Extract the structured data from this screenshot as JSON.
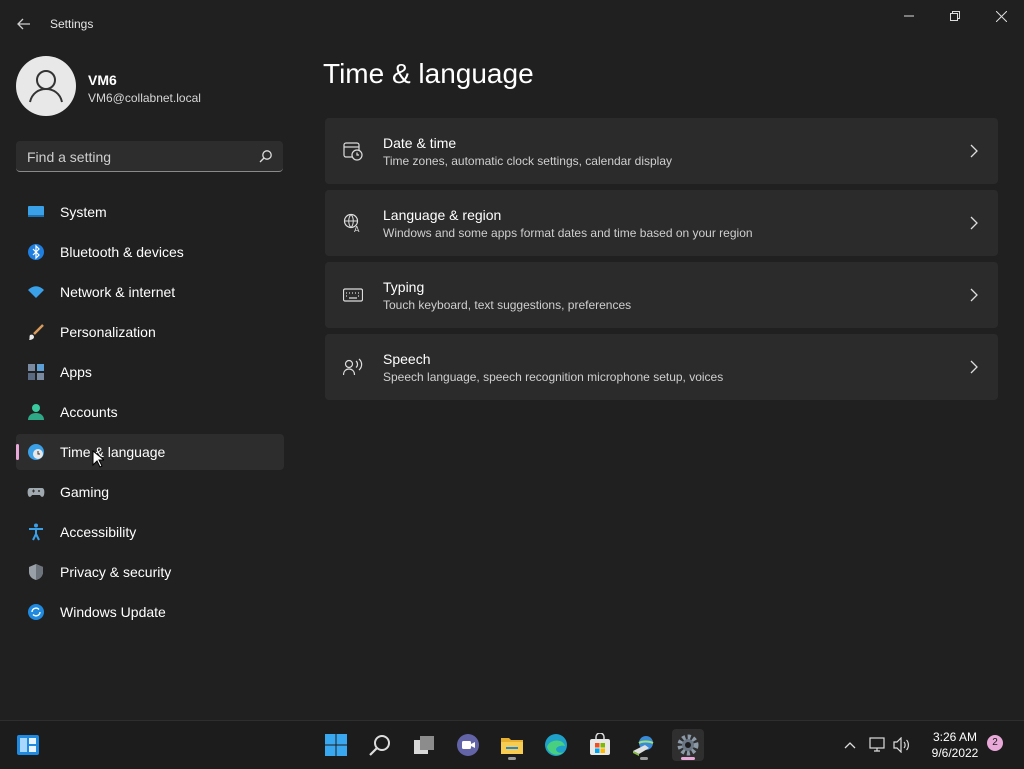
{
  "window": {
    "title": "Settings"
  },
  "profile": {
    "name": "VM6",
    "email": "VM6@collabnet.local"
  },
  "search": {
    "placeholder": "Find a setting"
  },
  "sidebar": {
    "items": [
      {
        "label": "System",
        "icon": "system-icon",
        "selected": false
      },
      {
        "label": "Bluetooth & devices",
        "icon": "bluetooth-icon",
        "selected": false
      },
      {
        "label": "Network & internet",
        "icon": "wifi-icon",
        "selected": false
      },
      {
        "label": "Personalization",
        "icon": "brush-icon",
        "selected": false
      },
      {
        "label": "Apps",
        "icon": "apps-icon",
        "selected": false
      },
      {
        "label": "Accounts",
        "icon": "accounts-icon",
        "selected": false
      },
      {
        "label": "Time & language",
        "icon": "globe-clock-icon",
        "selected": true
      },
      {
        "label": "Gaming",
        "icon": "controller-icon",
        "selected": false
      },
      {
        "label": "Accessibility",
        "icon": "accessibility-icon",
        "selected": false
      },
      {
        "label": "Privacy & security",
        "icon": "shield-icon",
        "selected": false
      },
      {
        "label": "Windows Update",
        "icon": "update-icon",
        "selected": false
      }
    ]
  },
  "main": {
    "title": "Time & language",
    "cards": [
      {
        "title": "Date & time",
        "subtitle": "Time zones, automatic clock settings, calendar display",
        "icon": "calendar-clock-icon"
      },
      {
        "title": "Language & region",
        "subtitle": "Windows and some apps format dates and time based on your region",
        "icon": "language-icon"
      },
      {
        "title": "Typing",
        "subtitle": "Touch keyboard, text suggestions, preferences",
        "icon": "keyboard-icon"
      },
      {
        "title": "Speech",
        "subtitle": "Speech language, speech recognition microphone setup, voices",
        "icon": "speech-icon"
      }
    ]
  },
  "taskbar": {
    "apps": [
      "start-icon",
      "search-icon",
      "task-view-icon",
      "chat-icon",
      "file-explorer-icon",
      "edge-icon",
      "store-icon",
      "network-app-icon",
      "settings-icon"
    ],
    "clock": {
      "time": "3:26 AM",
      "date": "9/6/2022"
    },
    "notifications": "2"
  },
  "colors": {
    "background": "#202020",
    "card": "#2b2b2b",
    "accent": "#e8a8d8",
    "taskbar": "#1c1c1c"
  }
}
